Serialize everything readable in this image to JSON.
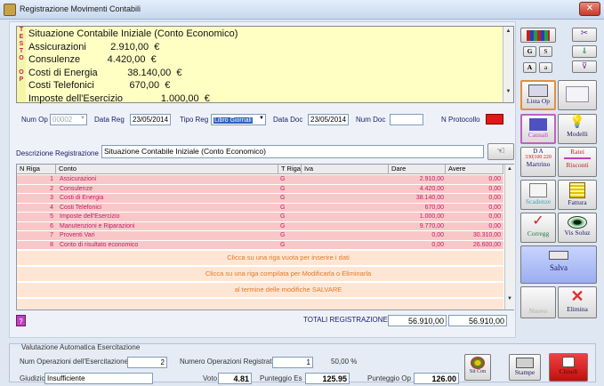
{
  "window": {
    "title": "Registrazione Movimenti Contabili",
    "close_label": "✕"
  },
  "notes": {
    "side_label": "T E S T O   O P",
    "lines": [
      "Situazione Contabile Iniziale (Conto Economico)",
      "Assicurazioni         2.910,00  €",
      "Consulenze          4.420,00  €",
      "Costi di Energia           38.140,00  €",
      "Costi Telefonici             670,00  €",
      "Imposte dell'Esercizio              1.000,00  €"
    ]
  },
  "form": {
    "num_op_label": "Num Op",
    "num_op_value": "00002",
    "data_reg_label": "Data Reg",
    "data_reg_value": "23/05/2014",
    "tipo_reg_label": "Tipo Reg",
    "tipo_reg_value": "Libro Giornali",
    "data_doc_label": "Data Doc",
    "data_doc_value": "23/05/2014",
    "num_doc_label": "Num Doc",
    "num_doc_value": "",
    "protocollo_label": "N Protocollo",
    "descrizione_label": "Descrizione Registrazione",
    "descrizione_value": "Situazione Contabile Iniziale (Conto Economico)"
  },
  "grid": {
    "headers": [
      "N Riga",
      "Conto",
      "T Riga",
      "Iva",
      "Dare",
      "Avere"
    ],
    "rows": [
      {
        "n": "1",
        "conto": "Assicurazioni",
        "t": "G",
        "dare": "2.910,00",
        "avere": "0,00"
      },
      {
        "n": "2",
        "conto": "Consulenze",
        "t": "G",
        "dare": "4.420,00",
        "avere": "0,00"
      },
      {
        "n": "3",
        "conto": "Costi di Energia",
        "t": "G",
        "dare": "38.140,00",
        "avere": "0,00"
      },
      {
        "n": "4",
        "conto": "Costi Telefonici",
        "t": "G",
        "dare": "670,00",
        "avere": "0,00"
      },
      {
        "n": "5",
        "conto": "Imposte dell'Esercizio",
        "t": "G",
        "dare": "1.000,00",
        "avere": "0,00"
      },
      {
        "n": "6",
        "conto": "Manutenzioni e Riparazioni",
        "t": "G",
        "dare": "9.770,00",
        "avere": "0,00"
      },
      {
        "n": "7",
        "conto": "Proventi Vari",
        "t": "G",
        "dare": "0,00",
        "avere": "30.310,00"
      },
      {
        "n": "8",
        "conto": "Conto di risultato economico",
        "t": "G",
        "dare": "0,00",
        "avere": "26.600,00"
      }
    ],
    "hint1": "Clicca su una riga vuota per inserire i dati",
    "hint2": "Clicca su una riga compilata per Modificarla o Eliminarla",
    "hint3": "al termine delle modifiche SALVARE"
  },
  "totals": {
    "label": "TOTALI REGISTRAZIONE",
    "dare": "56.910,00",
    "avere": "56.910,00"
  },
  "help_label": "?",
  "right_panel": {
    "font_buttons": [
      "G",
      "S",
      "A",
      "a"
    ],
    "lista_op": "Lista Op",
    "causali": "Causali",
    "modelli": "Modelli",
    "martrino_top": "D  A",
    "martrino_nums": "330|100  220",
    "martrino": "Martrino",
    "ratei": "Ratei",
    "risconti": "Risconti",
    "scadenze": "Scadenze",
    "fattura": "Fattura",
    "corregg": "Corregg",
    "vis_soluz": "Vis Soluz",
    "salva": "Salva",
    "nuovo": "Nuovo",
    "elimina": "Elimina"
  },
  "bottom": {
    "group_title": "Valutazione Automatica Esercitazione",
    "num_op_label": "Num Operazioni dell'Esercitazione",
    "num_op_value": "2",
    "num_reg_label": "Numero Operazioni Registrate",
    "num_reg_value": "1",
    "pct": "50,00 %",
    "giudizio_label": "Giudizio",
    "giudizio_value": "Insufficiente",
    "voto_label": "Voto",
    "voto_value": "4.81",
    "punt_es_label": "Punteggio Es",
    "punt_es_value": "125.95",
    "punt_op_label": "Punteggio Op",
    "punt_op_value": "126.00",
    "sit_con": "Sit Con",
    "stampe": "Stampe",
    "chiudi": "Chiudi"
  },
  "colors": {
    "row_pink": "#f8c8c8",
    "accent_red": "#e01818",
    "note_bg": "#ffffc4",
    "hint_orange": "#e07a28"
  }
}
